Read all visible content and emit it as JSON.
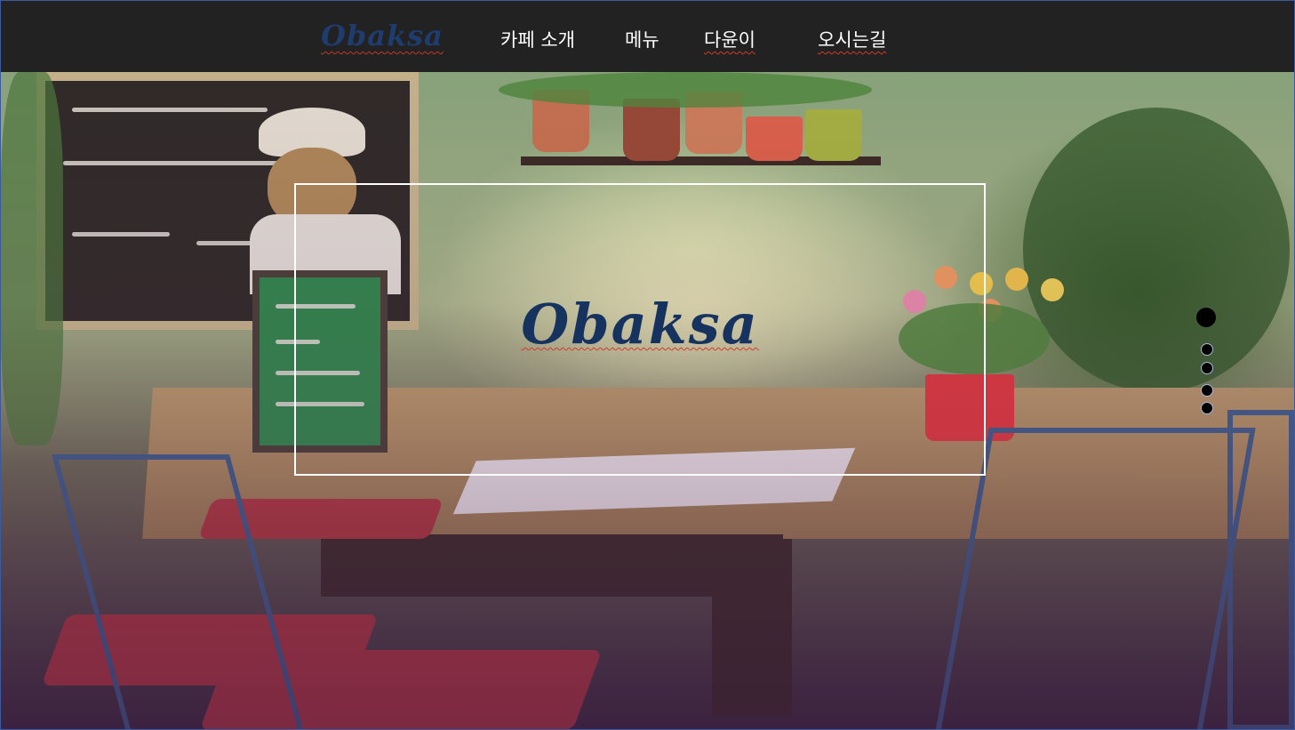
{
  "nav": {
    "logo": "Obaksa",
    "items": [
      {
        "label": "카페 소개"
      },
      {
        "label": "메뉴"
      },
      {
        "label": "다윤이"
      },
      {
        "label": "오시는길"
      }
    ]
  },
  "hero": {
    "title": "Obaksa",
    "slides": {
      "count": 5,
      "active_index": 0
    }
  },
  "colors": {
    "nav_background": "#222222",
    "logo": "#1f3c6e",
    "hero_title": "#16325f",
    "nav_text": "#ffffff",
    "box_border": "#ffffff"
  }
}
